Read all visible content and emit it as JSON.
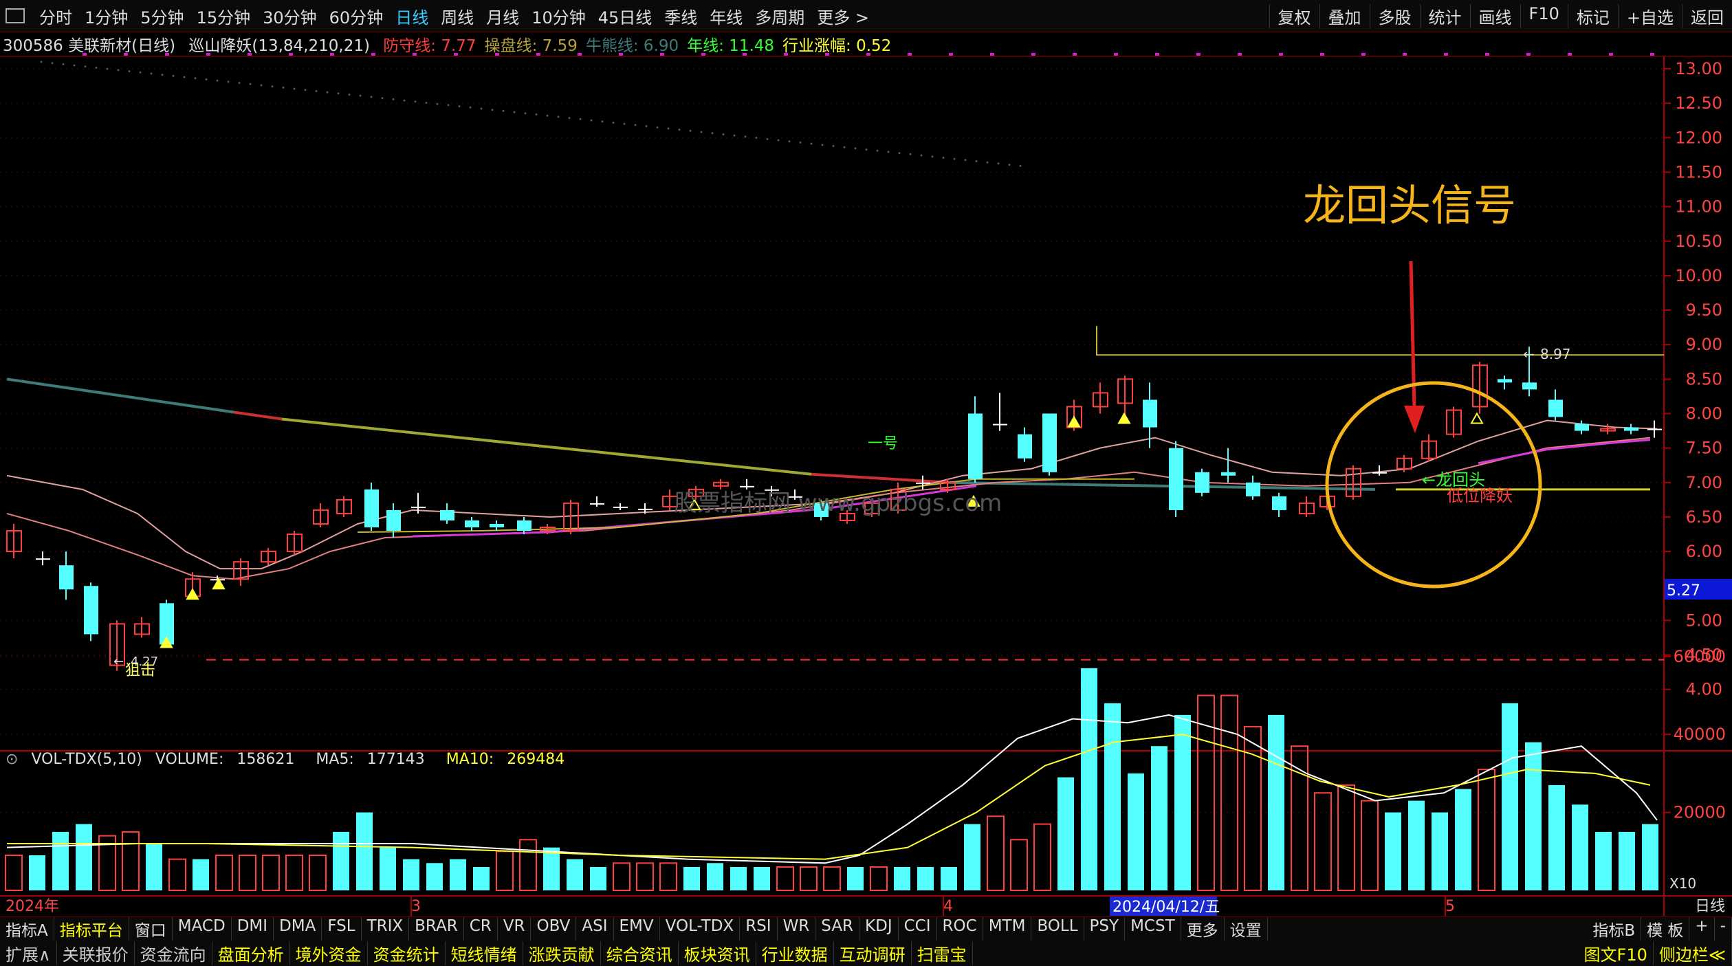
{
  "topbar": {
    "tabs": [
      {
        "label": "分时",
        "active": false
      },
      {
        "label": "1分钟",
        "active": false
      },
      {
        "label": "5分钟",
        "active": false
      },
      {
        "label": "15分钟",
        "active": false
      },
      {
        "label": "30分钟",
        "active": false
      },
      {
        "label": "60分钟",
        "active": false
      },
      {
        "label": "日线",
        "active": true
      },
      {
        "label": "周线",
        "active": false
      },
      {
        "label": "月线",
        "active": false
      },
      {
        "label": "10分钟",
        "active": false
      },
      {
        "label": "45日线",
        "active": false
      },
      {
        "label": "季线",
        "active": false
      },
      {
        "label": "年线",
        "active": false
      },
      {
        "label": "多周期",
        "active": false
      },
      {
        "label": "更多 >",
        "active": false
      }
    ],
    "tools": [
      "复权",
      "叠加",
      "多股",
      "统计",
      "画线",
      "F10",
      "标记",
      "+自选",
      "返回"
    ]
  },
  "infobar": {
    "stock": "300586 美联新材(日线)",
    "indicator": "巡山降妖(13,84,210,21)",
    "items": [
      {
        "label": "防守线:",
        "value": "7.77",
        "color": "#ff3b3b"
      },
      {
        "label": "操盘线:",
        "value": "7.59",
        "color": "#b5a33a"
      },
      {
        "label": "牛熊线:",
        "value": "6.90",
        "color": "#3e7a78"
      },
      {
        "label": "年线:",
        "value": "11.48",
        "color": "#33ff33"
      },
      {
        "label": "行业涨幅:",
        "value": "0.52",
        "color": "#ffff33"
      }
    ]
  },
  "price_axis": [
    "13.00",
    "12.50",
    "12.00",
    "11.50",
    "11.00",
    "10.50",
    "10.00",
    "9.50",
    "9.00",
    "8.50",
    "8.00",
    "7.50",
    "7.00",
    "6.50",
    "6.00",
    "5.00",
    "4.50",
    "4.00"
  ],
  "current_price_tag": "5.27",
  "annotations": {
    "signal_title": "龙回头信号",
    "high_label": "8.97",
    "low_label": "4.27",
    "snipe": "狙击",
    "first": "一号",
    "dragon": "←龙回头",
    "low_buy": "低位降妖",
    "watermark": "股票指标网 www.gpzbgs.com"
  },
  "volume": {
    "title": "VOL-TDX(5,10)",
    "volume_label": "VOLUME:",
    "volume_value": "158621",
    "ma5_label": "MA5:",
    "ma5_value": "177143",
    "ma10_label": "MA10:",
    "ma10_value": "269484",
    "axis": [
      "60000",
      "40000",
      "20000"
    ],
    "unit": "X10"
  },
  "date_axis": {
    "year": "2024年",
    "m3": "3",
    "m4": "4",
    "m5": "5",
    "cursor_date": "2024/04/12/五",
    "period": "日线"
  },
  "indicator_tabs": [
    "指标A",
    "指标平台",
    "窗口",
    "MACD",
    "DMI",
    "DMA",
    "FSL",
    "TRIX",
    "BRAR",
    "CR",
    "VR",
    "OBV",
    "ASI",
    "EMV",
    "VOL-TDX",
    "RSI",
    "WR",
    "SAR",
    "KDJ",
    "CCI",
    "ROC",
    "MTM",
    "BOLL",
    "PSY",
    "MCST",
    "更多",
    "设置"
  ],
  "indicator_right": [
    "指标B",
    "模 板",
    "+",
    "-"
  ],
  "bottom_tabs": [
    "扩展∧",
    "关联报价",
    "资金流向",
    "盘面分析",
    "境外资金",
    "资金统计",
    "短线情绪",
    "涨跌贡献",
    "综合资讯",
    "板块资讯",
    "行业数据",
    "互动调研",
    "扫雷宝"
  ],
  "bottom_right": [
    "图文F10",
    "侧边栏≪"
  ]
}
